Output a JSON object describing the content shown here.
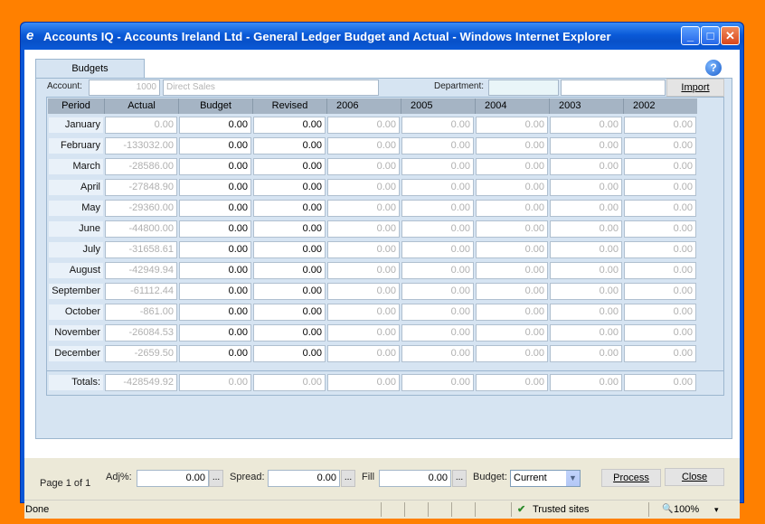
{
  "window": {
    "title": "Accounts IQ - Accounts Ireland Ltd - General Ledger Budget and Actual - Windows Internet Explorer",
    "minimize": "_",
    "maximize": "□",
    "close": "✕"
  },
  "tabs": [
    "Budgets"
  ],
  "help_icon": "?",
  "account": {
    "label": "Account:",
    "code": "1000",
    "name": "Direct Sales"
  },
  "department": {
    "label": "Department:",
    "code": "",
    "name": ""
  },
  "import_label": "Import",
  "columns": [
    "Period",
    "Actual",
    "Budget",
    "Revised",
    "2006",
    "2005",
    "2004",
    "2003",
    "2002"
  ],
  "rows": [
    {
      "period": "January",
      "actual": "0.00",
      "budget": "0.00",
      "revised": "0.00",
      "y2006": "0.00",
      "y2005": "0.00",
      "y2004": "0.00",
      "y2003": "0.00",
      "y2002": "0.00"
    },
    {
      "period": "February",
      "actual": "-133032.00",
      "budget": "0.00",
      "revised": "0.00",
      "y2006": "0.00",
      "y2005": "0.00",
      "y2004": "0.00",
      "y2003": "0.00",
      "y2002": "0.00"
    },
    {
      "period": "March",
      "actual": "-28586.00",
      "budget": "0.00",
      "revised": "0.00",
      "y2006": "0.00",
      "y2005": "0.00",
      "y2004": "0.00",
      "y2003": "0.00",
      "y2002": "0.00"
    },
    {
      "period": "April",
      "actual": "-27848.90",
      "budget": "0.00",
      "revised": "0.00",
      "y2006": "0.00",
      "y2005": "0.00",
      "y2004": "0.00",
      "y2003": "0.00",
      "y2002": "0.00"
    },
    {
      "period": "May",
      "actual": "-29360.00",
      "budget": "0.00",
      "revised": "0.00",
      "y2006": "0.00",
      "y2005": "0.00",
      "y2004": "0.00",
      "y2003": "0.00",
      "y2002": "0.00"
    },
    {
      "period": "June",
      "actual": "-44800.00",
      "budget": "0.00",
      "revised": "0.00",
      "y2006": "0.00",
      "y2005": "0.00",
      "y2004": "0.00",
      "y2003": "0.00",
      "y2002": "0.00"
    },
    {
      "period": "July",
      "actual": "-31658.61",
      "budget": "0.00",
      "revised": "0.00",
      "y2006": "0.00",
      "y2005": "0.00",
      "y2004": "0.00",
      "y2003": "0.00",
      "y2002": "0.00"
    },
    {
      "period": "August",
      "actual": "-42949.94",
      "budget": "0.00",
      "revised": "0.00",
      "y2006": "0.00",
      "y2005": "0.00",
      "y2004": "0.00",
      "y2003": "0.00",
      "y2002": "0.00"
    },
    {
      "period": "September",
      "actual": "-61112.44",
      "budget": "0.00",
      "revised": "0.00",
      "y2006": "0.00",
      "y2005": "0.00",
      "y2004": "0.00",
      "y2003": "0.00",
      "y2002": "0.00"
    },
    {
      "period": "October",
      "actual": "-861.00",
      "budget": "0.00",
      "revised": "0.00",
      "y2006": "0.00",
      "y2005": "0.00",
      "y2004": "0.00",
      "y2003": "0.00",
      "y2002": "0.00"
    },
    {
      "period": "November",
      "actual": "-26084.53",
      "budget": "0.00",
      "revised": "0.00",
      "y2006": "0.00",
      "y2005": "0.00",
      "y2004": "0.00",
      "y2003": "0.00",
      "y2002": "0.00"
    },
    {
      "period": "December",
      "actual": "-2659.50",
      "budget": "0.00",
      "revised": "0.00",
      "y2006": "0.00",
      "y2005": "0.00",
      "y2004": "0.00",
      "y2003": "0.00",
      "y2002": "0.00"
    }
  ],
  "totals": {
    "label": "Totals:",
    "actual": "-428549.92",
    "budget": "0.00",
    "revised": "0.00",
    "y2006": "0.00",
    "y2005": "0.00",
    "y2004": "0.00",
    "y2003": "0.00",
    "y2002": "0.00"
  },
  "bottom": {
    "page": "Page 1 of 1",
    "adj_label": "Adj%:",
    "adj_value": "0.00",
    "spread_label": "Spread:",
    "spread_value": "0.00",
    "fill_label": "Fill",
    "fill_value": "0.00",
    "ellipsis": "...",
    "budget_label": "Budget:",
    "budget_value": "Current",
    "process_label": "Process",
    "close_label": "Close"
  },
  "statusbar": {
    "status": "Done",
    "zone": "Trusted sites",
    "zoom": "100%",
    "zoom_arrow": "▾"
  }
}
